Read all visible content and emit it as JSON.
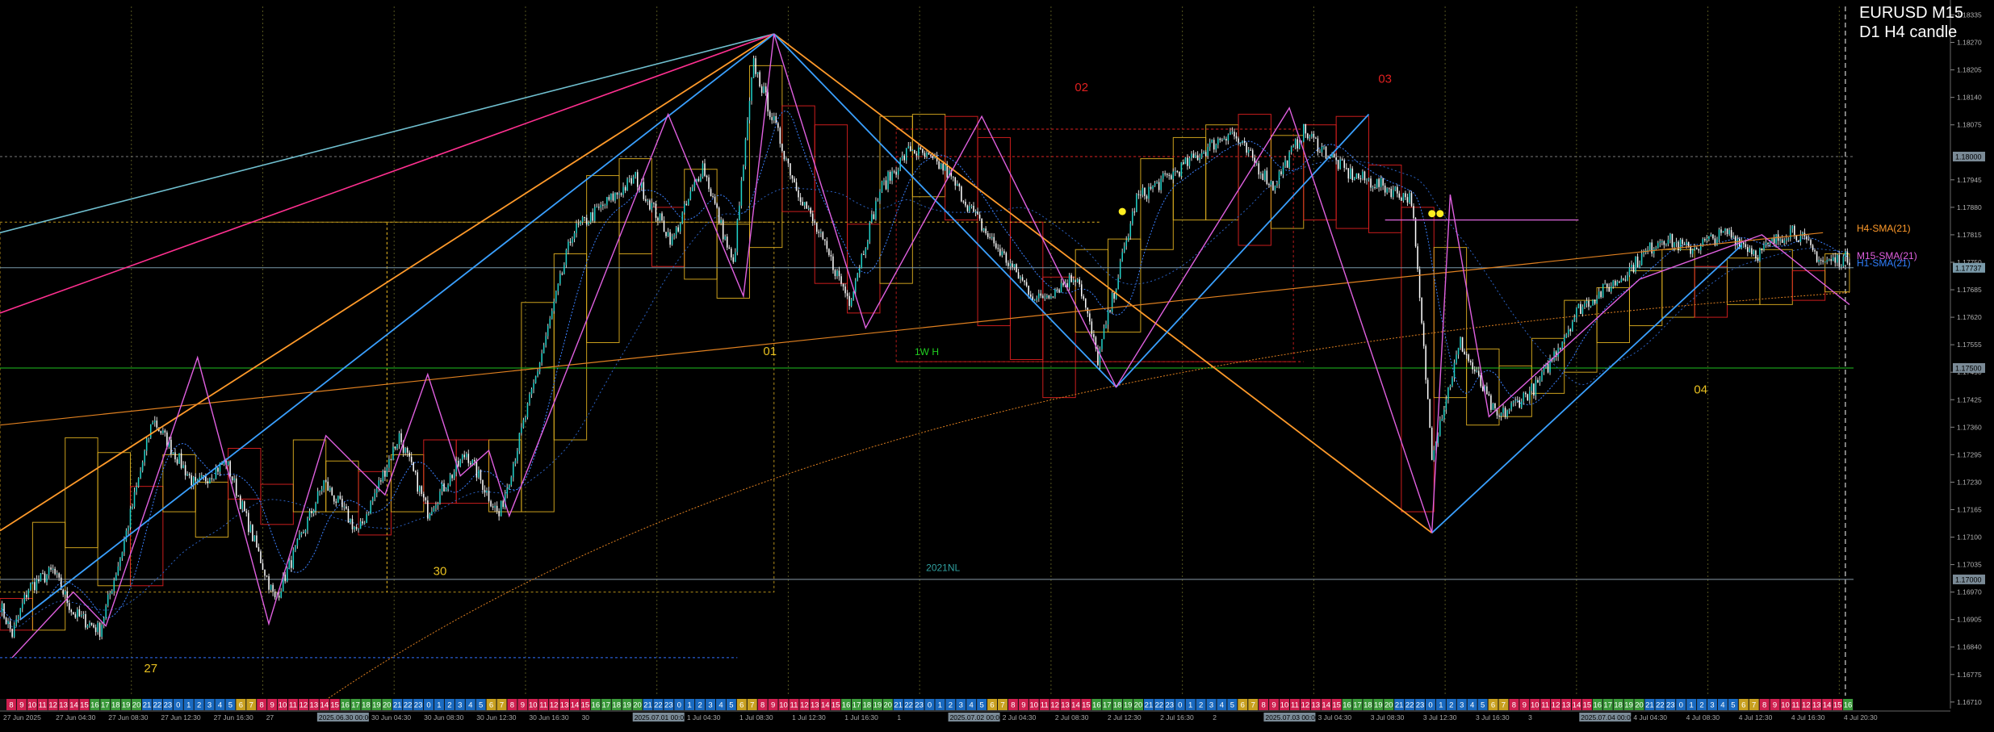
{
  "header": {
    "symbol_timeframe": "EURUSD M15",
    "subtitle": "D1 H4 candle"
  },
  "chart_data": {
    "type": "candlestick",
    "symbol": "EURUSD",
    "timeframe": "M15",
    "ylim": [
      1.16725,
      1.18355
    ],
    "price_ticks": [
      "1.18335",
      "1.18270",
      "1.18205",
      "1.18140",
      "1.18075",
      "1.17945",
      "1.17880",
      "1.17815",
      "1.17750",
      "1.17685",
      "1.17620",
      "1.17555",
      "1.17490",
      "1.17425",
      "1.17360",
      "1.17295",
      "1.17230",
      "1.17165",
      "1.17100",
      "1.17035",
      "1.16970",
      "1.16905",
      "1.16840",
      "1.16775",
      "1.16710"
    ],
    "price_tags": [
      {
        "value": "1.18000",
        "price": 1.18,
        "style": "line-tag"
      },
      {
        "value": "1.17737",
        "price": 1.17737,
        "style": "current"
      },
      {
        "value": "1.17500",
        "price": 1.175,
        "style": "line-tag"
      },
      {
        "value": "1.17000",
        "price": 1.17,
        "style": "line-tag"
      }
    ],
    "bottom_time_axis": [
      "27 Jun 2025",
      "27 Jun 04:30",
      "27 Jun 08:30",
      "27 Jun 12:30",
      "27 Jun 16:30",
      "27",
      "2025.06.30 00:00",
      "30 Jun 04:30",
      "30 Jun 08:30",
      "30 Jun 12:30",
      "30 Jun 16:30",
      "30",
      "2025.07.01 00:00",
      "1 Jul 04:30",
      "1 Jul 08:30",
      "1 Jul 12:30",
      "1 Jul 16:30",
      "1",
      "2025.07.02 00:00",
      "2 Jul 04:30",
      "2 Jul 08:30",
      "2 Jul 12:30",
      "2 Jul 16:30",
      "2",
      "2025.07.03 00:00",
      "3 Jul 04:30",
      "3 Jul 08:30",
      "3 Jul 12:30",
      "3 Jul 16:30",
      "3",
      "2025.07.04 00:00",
      "4 Jul 04:30",
      "4 Jul 08:30",
      "4 Jul 12:30",
      "4 Jul 16:30",
      "4 Jul 20:30"
    ],
    "hour_strip": {
      "pattern": [
        "8",
        "9",
        "10",
        "11",
        "12",
        "13",
        "14",
        "15",
        "16",
        "17",
        "18",
        "19",
        "20",
        "21",
        "22",
        "23",
        "0",
        "1",
        "2",
        "3",
        "4",
        "5",
        "6",
        "7"
      ],
      "first_hour": "8",
      "last_hour": "5"
    },
    "day_labels": [
      {
        "text": "27",
        "color": "#e8c020",
        "day_index": 0
      },
      {
        "text": "30",
        "color": "#e8c020",
        "day_index": 1
      },
      {
        "text": "01",
        "color": "#e8c020",
        "day_index": 2
      },
      {
        "text": "02",
        "color": "#e02020",
        "day_index": 3
      },
      {
        "text": "03",
        "color": "#e02020",
        "day_index": 4
      },
      {
        "text": "04",
        "color": "#e8c020",
        "day_index": 5
      }
    ],
    "annotations": [
      {
        "text": "1W H",
        "color": "#20d020"
      },
      {
        "text": "2021NL",
        "color": "#30a0a0"
      }
    ],
    "indicators": [
      {
        "name": "H4-SMA(21)",
        "color": "#ff9a2a"
      },
      {
        "name": "M15-SMA(21)",
        "color": "#e060e0"
      },
      {
        "name": "H1-SMA(21)",
        "color": "#3080ff"
      }
    ],
    "horizontal_levels": [
      {
        "price": 1.175,
        "color": "#20c020",
        "style": "solid"
      },
      {
        "price": 1.17,
        "color": "#8a9aa8",
        "style": "solid"
      },
      {
        "price": 1.17737,
        "color": "#7a9aaa",
        "style": "solid"
      },
      {
        "price": 1.18,
        "color": "#7a7a7a",
        "style": "dotted"
      }
    ],
    "series": [
      {
        "name": "M15 close (approx)",
        "points": [
          [
            0,
            1.1694
          ],
          [
            6,
            1.1687
          ],
          [
            14,
            1.1698
          ],
          [
            26,
            1.1702
          ],
          [
            36,
            1.1692
          ],
          [
            49,
            1.1688
          ],
          [
            60,
            1.1707
          ],
          [
            75,
            1.1738
          ],
          [
            96,
            1.1722
          ],
          [
            111,
            1.1728
          ],
          [
            135,
            1.1695
          ],
          [
            159,
            1.1723
          ],
          [
            176,
            1.1711
          ],
          [
            196,
            1.1734
          ],
          [
            210,
            1.1716
          ],
          [
            229,
            1.173
          ],
          [
            245,
            1.1715
          ],
          [
            261,
            1.1744
          ],
          [
            281,
            1.1782
          ],
          [
            312,
            1.1795
          ],
          [
            330,
            1.178
          ],
          [
            345,
            1.1798
          ],
          [
            360,
            1.1774
          ],
          [
            370,
            1.1822
          ],
          [
            390,
            1.1794
          ],
          [
            417,
            1.1766
          ],
          [
            432,
            1.1792
          ],
          [
            447,
            1.1802
          ],
          [
            464,
            1.1797
          ],
          [
            484,
            1.1782
          ],
          [
            509,
            1.1766
          ],
          [
            529,
            1.1772
          ],
          [
            539,
            1.1752
          ],
          [
            558,
            1.179
          ],
          [
            579,
            1.1797
          ],
          [
            604,
            1.1806
          ],
          [
            625,
            1.1793
          ],
          [
            640,
            1.1806
          ],
          [
            662,
            1.1796
          ],
          [
            679,
            1.1793
          ],
          [
            693,
            1.179
          ],
          [
            703,
            1.173
          ],
          [
            717,
            1.1756
          ],
          [
            735,
            1.1738
          ],
          [
            755,
            1.1746
          ],
          [
            775,
            1.1764
          ],
          [
            795,
            1.1771
          ],
          [
            816,
            1.1781
          ],
          [
            829,
            1.1778
          ],
          [
            848,
            1.1782
          ],
          [
            863,
            1.1777
          ],
          [
            880,
            1.1783
          ],
          [
            895,
            1.1775
          ],
          [
            908,
            1.1776
          ]
        ]
      }
    ]
  }
}
